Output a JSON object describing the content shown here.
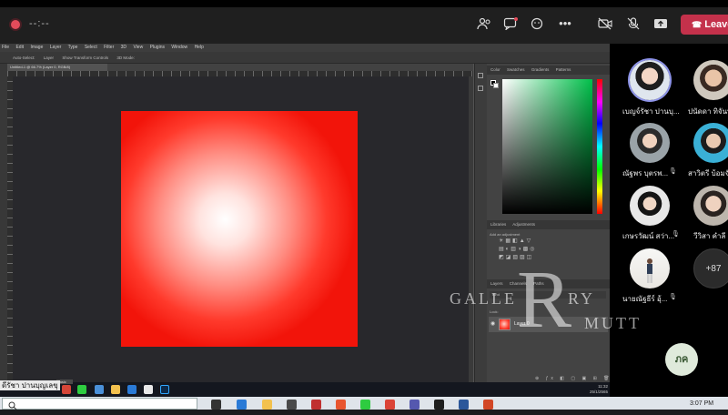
{
  "meeting": {
    "timer": "--:--",
    "leave_label": "Leave",
    "icons": [
      "people-icon",
      "chat-icon",
      "reactions-icon",
      "more-icon",
      "camera-off-icon",
      "mic-off-icon",
      "share-icon"
    ]
  },
  "photoshop": {
    "menu": [
      "File",
      "Edit",
      "Image",
      "Layer",
      "Type",
      "Select",
      "Filter",
      "3D",
      "View",
      "Plugins",
      "Window",
      "Help"
    ],
    "options": [
      "Auto-Select:",
      "Layer",
      "Show Transform Controls",
      "3D Mode:"
    ],
    "doc_tab": "Untitled-1 @ 66.7% (Layer 0, RGB/8)",
    "color_tabs": [
      "Color",
      "Swatches",
      "Gradients",
      "Patterns"
    ],
    "adjust_tabs": [
      "Libraries",
      "Adjustments"
    ],
    "adjust_sub": "Add an adjustment",
    "layers_tabs": [
      "Layers",
      "Channels",
      "Paths"
    ],
    "layers_kind": "Kind",
    "layers_lock": "Lock:",
    "layer_name": "Layer 0",
    "tooltip": "ดีรัชา ปานบุญเลขุ",
    "tooltip_tab": "Basic",
    "tray_time": "11:32",
    "tray_date": "25/1/2565"
  },
  "participants": [
    {
      "name": "เบญจ์รัชา ปานบุ...",
      "speaking": true,
      "muted": false
    },
    {
      "name": "ปนัดดา ทิจันทา",
      "speaking": false,
      "muted": false
    },
    {
      "name": "ณัฐพร บุตรพ...",
      "speaking": false,
      "muted": true
    },
    {
      "name": "สาวิตรี บ้อมจั...",
      "speaking": false,
      "muted": true
    },
    {
      "name": "เกษรวัฒน์ สว่า...",
      "speaking": false,
      "muted": true
    },
    {
      "name": "วีวิสา คำลี",
      "speaking": false,
      "muted": true
    },
    {
      "name": "นายณัฐธีร์ อุ้...",
      "speaking": false,
      "muted": true
    }
  ],
  "more_count": "+87",
  "self_initials": "ภค",
  "watermark": {
    "left": "GALLE",
    "big": "R",
    "ry": "RY",
    "right": "MUTT"
  },
  "os": {
    "time": "3:07 PM"
  },
  "colors": {
    "accent": "#8d93e8",
    "leave": "#c4314b",
    "canvas_red": "#f2140a"
  }
}
